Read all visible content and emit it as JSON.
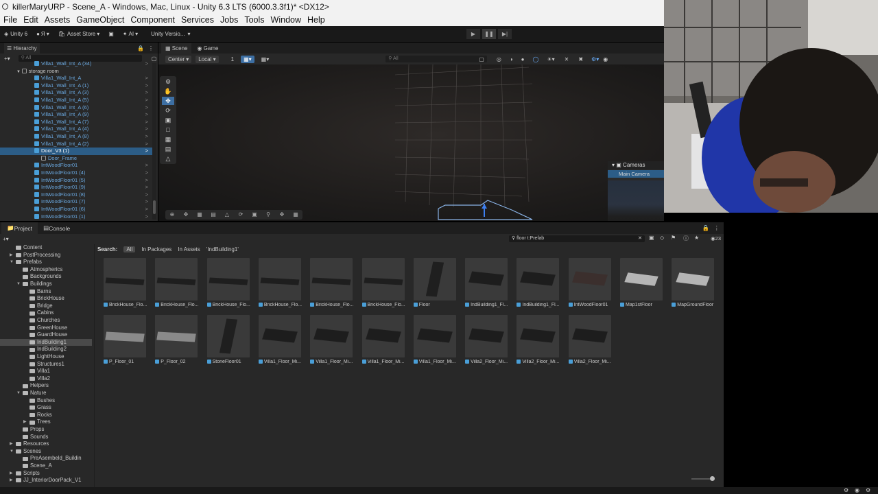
{
  "window": {
    "title": "killerMaryURP - Scene_A - Windows, Mac, Linux - Unity 6.3 LTS (6000.3.3f1)* <DX12>"
  },
  "menu": [
    "File",
    "Edit",
    "Assets",
    "GameObject",
    "Component",
    "Services",
    "Jobs",
    "Tools",
    "Window",
    "Help"
  ],
  "toolbar": {
    "logo": "Unity 6",
    "account": "Я",
    "asset_store": "Asset Store",
    "ai": "AI",
    "version_control": "Unity Versio..."
  },
  "hierarchy": {
    "tab": "Hierarchy",
    "search_placeholder": "All",
    "rows": [
      {
        "label": "Villa1_Wall_Int_A (34)",
        "indent": 50,
        "type": "prefab"
      },
      {
        "label": "storage room",
        "indent": 34,
        "type": "object",
        "expanded": true
      },
      {
        "label": "Villa1_Wall_Int_A",
        "indent": 50,
        "type": "prefab"
      },
      {
        "label": "Villa1_Wall_Int_A (1)",
        "indent": 50,
        "type": "prefab"
      },
      {
        "label": "Villa1_Wall_Int_A (3)",
        "indent": 50,
        "type": "prefab"
      },
      {
        "label": "Villa1_Wall_Int_A (5)",
        "indent": 50,
        "type": "prefab"
      },
      {
        "label": "Villa1_Wall_Int_A (6)",
        "indent": 50,
        "type": "prefab"
      },
      {
        "label": "Villa1_Wall_Int_A (9)",
        "indent": 50,
        "type": "prefab"
      },
      {
        "label": "Villa1_Wall_Int_A (7)",
        "indent": 50,
        "type": "prefab"
      },
      {
        "label": "Villa1_Wall_Int_A (4)",
        "indent": 50,
        "type": "prefab"
      },
      {
        "label": "Villa1_Wall_Int_A (8)",
        "indent": 50,
        "type": "prefab"
      },
      {
        "label": "Villa1_Wall_Int_A (2)",
        "indent": 50,
        "type": "prefab"
      },
      {
        "label": "Door_V3 (1)",
        "indent": 50,
        "type": "selected"
      },
      {
        "label": "Door_Frame",
        "indent": 60,
        "type": "child"
      },
      {
        "label": "IntWoodFloor01",
        "indent": 50,
        "type": "prefab"
      },
      {
        "label": "IntWoodFloor01 (4)",
        "indent": 50,
        "type": "prefab"
      },
      {
        "label": "IntWoodFloor01 (5)",
        "indent": 50,
        "type": "prefab"
      },
      {
        "label": "IntWoodFloor01 (9)",
        "indent": 50,
        "type": "prefab"
      },
      {
        "label": "IntWoodFloor01 (8)",
        "indent": 50,
        "type": "prefab"
      },
      {
        "label": "IntWoodFloor01 (7)",
        "indent": 50,
        "type": "prefab"
      },
      {
        "label": "IntWoodFloor01 (6)",
        "indent": 50,
        "type": "prefab"
      },
      {
        "label": "IntWoodFloor01 (1)",
        "indent": 50,
        "type": "prefab"
      }
    ]
  },
  "scene": {
    "tabs": [
      "Scene",
      "Game"
    ],
    "pivot": "Center",
    "space": "Local",
    "grid_snap": "1",
    "search_placeholder": "All",
    "cameras_overlay": {
      "title": "Cameras",
      "item": "Main Camera"
    }
  },
  "project": {
    "tabs": [
      "Project",
      "Console"
    ],
    "search_value": "floor t:Prefab",
    "result_count": "23",
    "search_label": "Search:",
    "filters": [
      "All",
      "In Packages",
      "In Assets",
      "'IndBuilding1'"
    ],
    "folders": [
      {
        "label": "Content",
        "depth": 1,
        "arrow": ""
      },
      {
        "label": "PostProcessing",
        "depth": 1,
        "arrow": "▶"
      },
      {
        "label": "Prefabs",
        "depth": 1,
        "arrow": "▼"
      },
      {
        "label": "Atmospherics",
        "depth": 2,
        "arrow": ""
      },
      {
        "label": "Backgrounds",
        "depth": 2,
        "arrow": ""
      },
      {
        "label": "Buildings",
        "depth": 2,
        "arrow": "▼"
      },
      {
        "label": "Barns",
        "depth": 3,
        "arrow": ""
      },
      {
        "label": "BrickHouse",
        "depth": 3,
        "arrow": ""
      },
      {
        "label": "Bridge",
        "depth": 3,
        "arrow": ""
      },
      {
        "label": "Cabins",
        "depth": 3,
        "arrow": ""
      },
      {
        "label": "Churches",
        "depth": 3,
        "arrow": ""
      },
      {
        "label": "GreenHouse",
        "depth": 3,
        "arrow": ""
      },
      {
        "label": "GuardHouse",
        "depth": 3,
        "arrow": ""
      },
      {
        "label": "IndBuilding1",
        "depth": 3,
        "arrow": "",
        "selected": true
      },
      {
        "label": "IndBuilding2",
        "depth": 3,
        "arrow": ""
      },
      {
        "label": "LightHouse",
        "depth": 3,
        "arrow": ""
      },
      {
        "label": "Structures1",
        "depth": 3,
        "arrow": ""
      },
      {
        "label": "Villa1",
        "depth": 3,
        "arrow": ""
      },
      {
        "label": "Villa2",
        "depth": 3,
        "arrow": ""
      },
      {
        "label": "Helpers",
        "depth": 2,
        "arrow": ""
      },
      {
        "label": "Nature",
        "depth": 2,
        "arrow": "▼"
      },
      {
        "label": "Bushes",
        "depth": 3,
        "arrow": ""
      },
      {
        "label": "Grass",
        "depth": 3,
        "arrow": ""
      },
      {
        "label": "Rocks",
        "depth": 3,
        "arrow": ""
      },
      {
        "label": "Trees",
        "depth": 3,
        "arrow": "▶"
      },
      {
        "label": "Props",
        "depth": 2,
        "arrow": ""
      },
      {
        "label": "Sounds",
        "depth": 2,
        "arrow": ""
      },
      {
        "label": "Resources",
        "depth": 1,
        "arrow": "▶"
      },
      {
        "label": "Scenes",
        "depth": 1,
        "arrow": "▼"
      },
      {
        "label": "PreAsembeld_Buildin",
        "depth": 2,
        "arrow": ""
      },
      {
        "label": "Scene_A",
        "depth": 2,
        "arrow": ""
      },
      {
        "label": "Scripts",
        "depth": 1,
        "arrow": "▶"
      },
      {
        "label": "JJ_InteriorDoorPack_V1",
        "depth": 1,
        "arrow": "▶"
      }
    ],
    "assets": [
      {
        "label": "BrickHouse_Flo...",
        "kind": "slab-dark"
      },
      {
        "label": "BrickHouse_Flo...",
        "kind": "slab-dark"
      },
      {
        "label": "BrickHouse_Flo...",
        "kind": "slab-dark"
      },
      {
        "label": "BrickHouse_Flo...",
        "kind": "slab-dark"
      },
      {
        "label": "BrickHouse_Flo...",
        "kind": "slab-dark"
      },
      {
        "label": "BrickHouse_Flo...",
        "kind": "slab-dark"
      },
      {
        "label": "Floor",
        "kind": "panel"
      },
      {
        "label": "IndBuilding1_Fl...",
        "kind": "block"
      },
      {
        "label": "IndBuilding1_Fl...",
        "kind": "block"
      },
      {
        "label": "IntWoodFloor01",
        "kind": "block-brown"
      },
      {
        "label": "Map1stFloor",
        "kind": "block-light"
      },
      {
        "label": "MapGroundFloor",
        "kind": "block-light"
      },
      {
        "label": "P_Floor_01",
        "kind": "slab-grey"
      },
      {
        "label": "P_Floor_02",
        "kind": "slab-grey"
      },
      {
        "label": "StoneFloor01",
        "kind": "panel"
      },
      {
        "label": "Villa1_Floor_Mi...",
        "kind": "block"
      },
      {
        "label": "Villa1_Floor_Mi...",
        "kind": "block"
      },
      {
        "label": "Villa1_Floor_Mi...",
        "kind": "block"
      },
      {
        "label": "Villa1_Floor_Mi...",
        "kind": "block"
      },
      {
        "label": "Villa2_Floor_Mi...",
        "kind": "block"
      },
      {
        "label": "Villa2_Floor_Mi...",
        "kind": "block"
      },
      {
        "label": "Villa2_Floor_Mi...",
        "kind": "block"
      }
    ]
  }
}
